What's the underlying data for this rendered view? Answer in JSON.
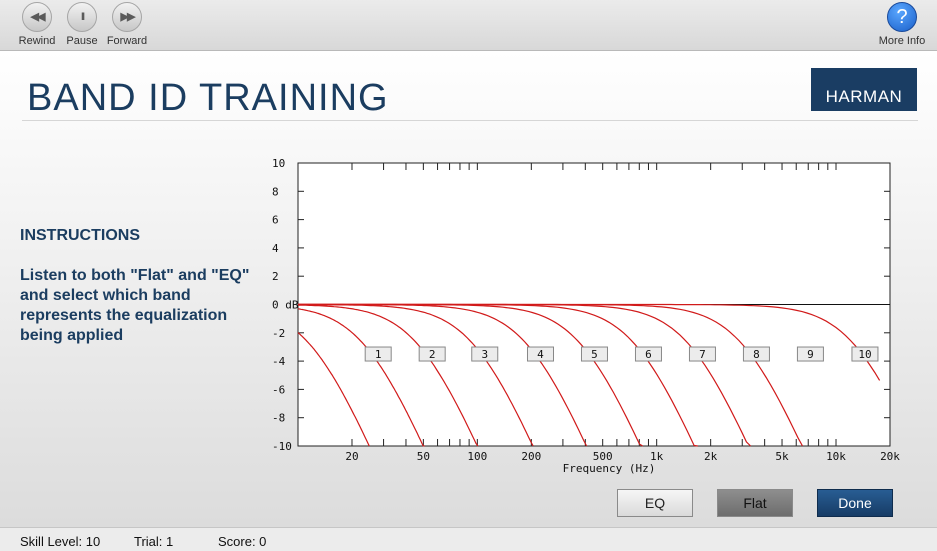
{
  "toolbar": {
    "rewind_label": "Rewind",
    "pause_label": "Pause",
    "forward_label": "Forward",
    "more_info_label": "More Info",
    "rewind_icon": "◀◀",
    "pause_icon": "II",
    "forward_icon": "▶▶",
    "help_icon": "?"
  },
  "header": {
    "title": "BAND ID TRAINING",
    "logo": "HARMAN"
  },
  "instructions": {
    "heading": "INSTRUCTIONS",
    "text": "Listen to both \"Flat\" and \"EQ\" and select which band represents the equalization being applied"
  },
  "chart_data": {
    "type": "line",
    "xlabel": "Frequency (Hz)",
    "ylabel": "",
    "xscale": "log",
    "xlim": [
      10,
      20000
    ],
    "ylim": [
      -10,
      10
    ],
    "y_ticks": [
      10,
      8,
      6,
      4,
      2,
      0,
      -2,
      -4,
      -6,
      -8,
      -10
    ],
    "y_tick_labels": [
      "10",
      "8",
      "6",
      "4",
      "2",
      "0 dB",
      "-2",
      "-4",
      "-6",
      "-8",
      "-10"
    ],
    "x_tick_labels": [
      {
        "value": 20,
        "label": "20"
      },
      {
        "value": 50,
        "label": "50"
      },
      {
        "value": 100,
        "label": "100"
      },
      {
        "value": 200,
        "label": "200"
      },
      {
        "value": 500,
        "label": "500"
      },
      {
        "value": 1000,
        "label": "1k"
      },
      {
        "value": 2000,
        "label": "2k"
      },
      {
        "value": 5000,
        "label": "5k"
      },
      {
        "value": 10000,
        "label": "10k"
      },
      {
        "value": 20000,
        "label": "20k"
      }
    ],
    "bands": [
      {
        "label": "1",
        "x": 28,
        "cutoff": 12,
        "y_end_freq": 47
      },
      {
        "label": "2",
        "x": 56,
        "cutoff": 24,
        "y_end_freq": 94
      },
      {
        "label": "3",
        "x": 110,
        "cutoff": 48,
        "y_end_freq": 185
      },
      {
        "label": "4",
        "x": 225,
        "cutoff": 98,
        "y_end_freq": 375
      },
      {
        "label": "5",
        "x": 450,
        "cutoff": 195,
        "y_end_freq": 750
      },
      {
        "label": "6",
        "x": 900,
        "cutoff": 390,
        "y_end_freq": 1500
      },
      {
        "label": "7",
        "x": 1800,
        "cutoff": 780,
        "y_end_freq": 3000
      },
      {
        "label": "8",
        "x": 3600,
        "cutoff": 1560,
        "y_end_freq": 6000
      },
      {
        "label": "9",
        "x": 7200,
        "cutoff": 3100,
        "y_end_freq": 11000
      },
      {
        "label": "10",
        "x": 14500,
        "cutoff": 13000,
        "y_end_freq": 17500
      }
    ],
    "band_label_y": -3.5,
    "line_color": "#d11a1a"
  },
  "buttons": {
    "eq": "EQ",
    "flat": "Flat",
    "done": "Done"
  },
  "status": {
    "skill": "Skill Level: 10",
    "trial": "Trial: 1",
    "score": "Score: 0"
  }
}
